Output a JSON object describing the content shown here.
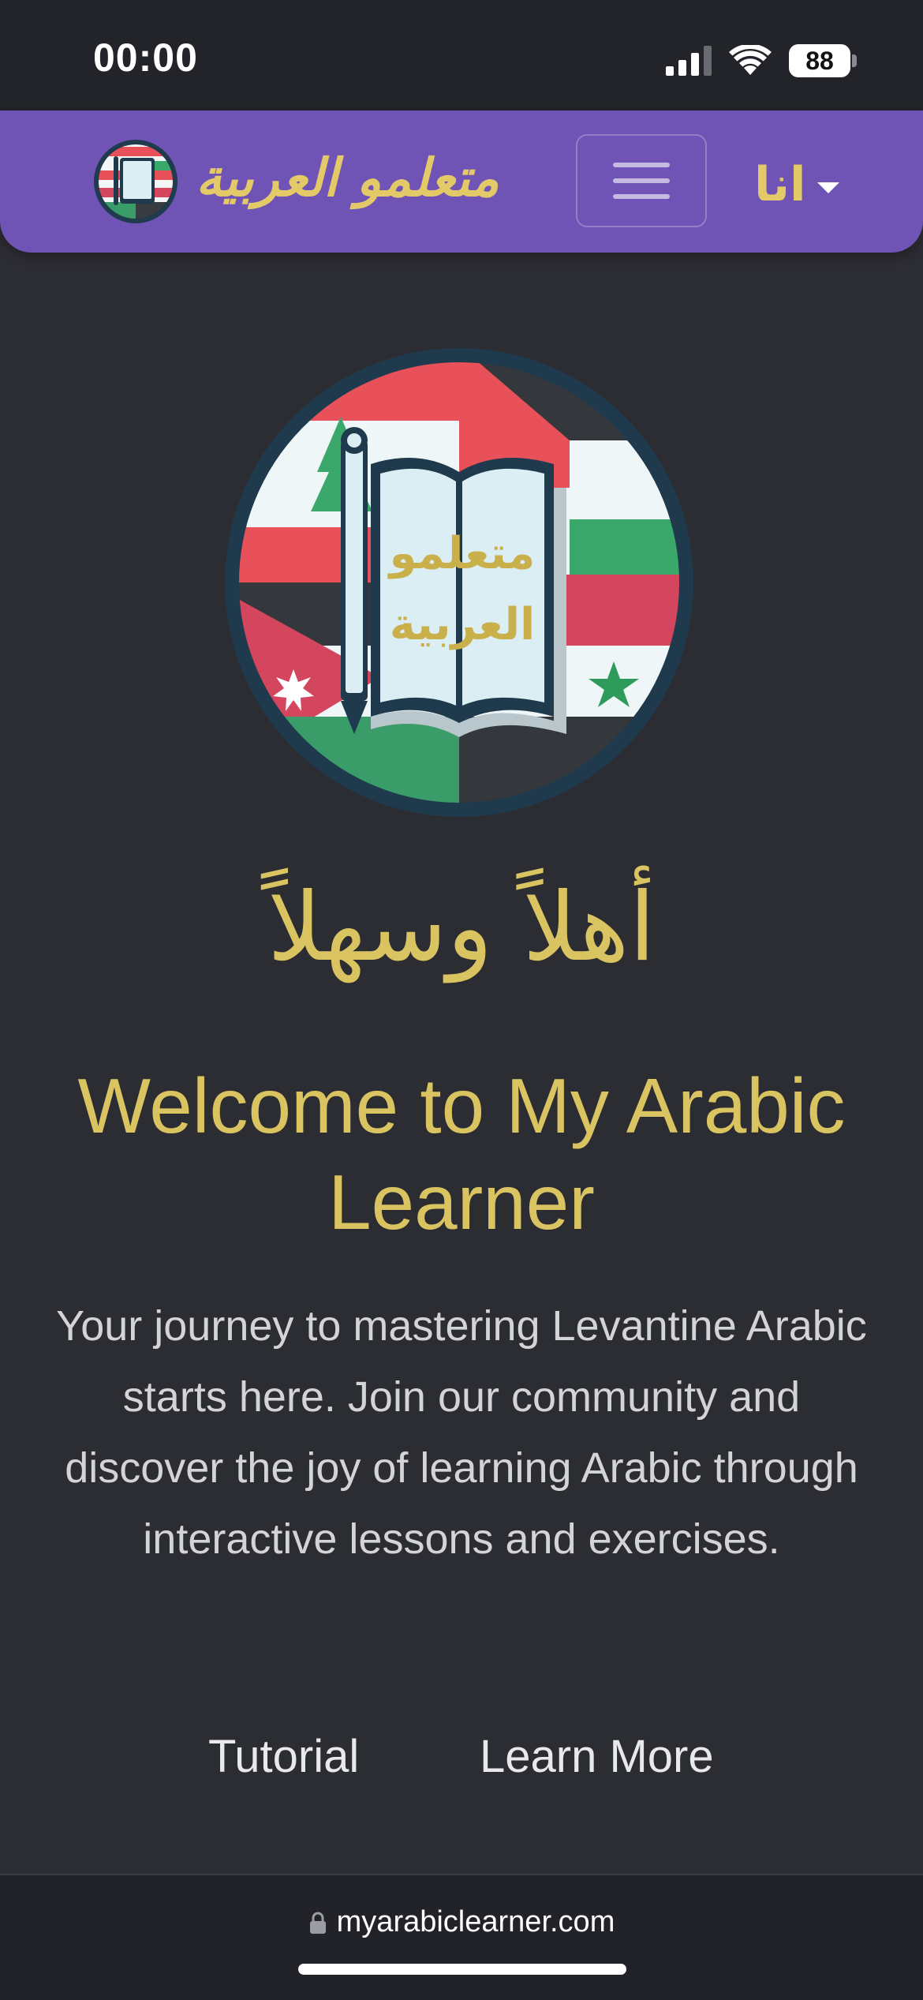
{
  "status_bar": {
    "time": "00:00",
    "battery_level": "88",
    "icons": [
      "signal-icon",
      "wifi-icon",
      "battery-icon"
    ]
  },
  "navbar": {
    "brand_text": "متعلمو العربية",
    "logo_icon": "my-arabic-learner-logo-icon",
    "menu_toggle_icon": "hamburger-menu-icon",
    "language_label": "انا",
    "language_caret_icon": "caret-down-icon"
  },
  "hero": {
    "logo_text_line1": "متعلمو",
    "logo_text_line2": "العربية",
    "arabic_greeting": "أهلاً وسهلاً",
    "title": "Welcome to My Arabic Learner",
    "intro": "Your journey to mastering Levantine Arabic starts here. Join our community and discover the joy of learning Arabic through interactive lessons and exercises.",
    "buttons": {
      "tutorial": "Tutorial",
      "learn_more": "Learn More"
    }
  },
  "browser": {
    "url": "myarabiclearner.com",
    "lock_icon": "lock-icon"
  },
  "colors": {
    "navbar_bg": "#6f54b5",
    "gold_accent": "#d9c461",
    "page_bg": "#2c2c33",
    "status_bar_bg": "#232429"
  }
}
